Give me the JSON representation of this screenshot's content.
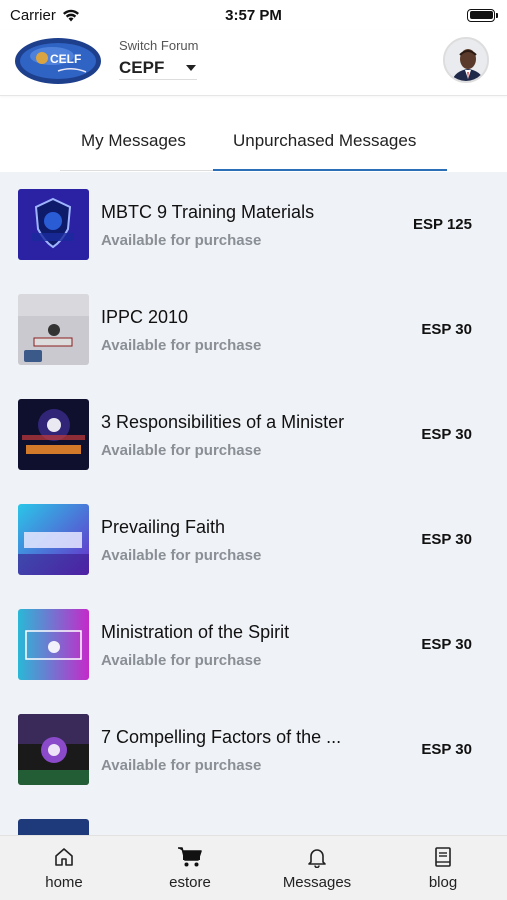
{
  "status_bar": {
    "carrier": "Carrier",
    "time": "3:57 PM"
  },
  "header": {
    "forum_label": "Switch Forum",
    "forum_value": "CEPF",
    "logo_text": "CELF"
  },
  "tabs": [
    {
      "label": "My Messages",
      "selected": false
    },
    {
      "label": "Unpurchased Messages",
      "selected": true
    }
  ],
  "messages": [
    {
      "title": "MBTC 9 Training Materials",
      "status": "Available for purchase",
      "price": "ESP 125"
    },
    {
      "title": "IPPC 2010",
      "status": "Available for purchase",
      "price": "ESP 30"
    },
    {
      "title": "3 Responsibilities of a Minister",
      "status": "Available for purchase",
      "price": "ESP 30"
    },
    {
      "title": "Prevailing Faith",
      "status": "Available for purchase",
      "price": "ESP 30"
    },
    {
      "title": "Ministration of the Spirit",
      "status": "Available for purchase",
      "price": "ESP 30"
    },
    {
      "title": "7 Compelling Factors of the ...",
      "status": "Available for purchase",
      "price": "ESP 30"
    }
  ],
  "tabbar": [
    {
      "label": "home",
      "icon": "home-icon",
      "active": false
    },
    {
      "label": "estore",
      "icon": "cart-icon",
      "active": true
    },
    {
      "label": "Messages",
      "icon": "bell-icon",
      "active": false
    },
    {
      "label": "blog",
      "icon": "book-icon",
      "active": false
    }
  ],
  "colors": {
    "accent": "#2a6fb7",
    "list_bg": "#eff2f6",
    "subtext": "#8a8f96"
  }
}
